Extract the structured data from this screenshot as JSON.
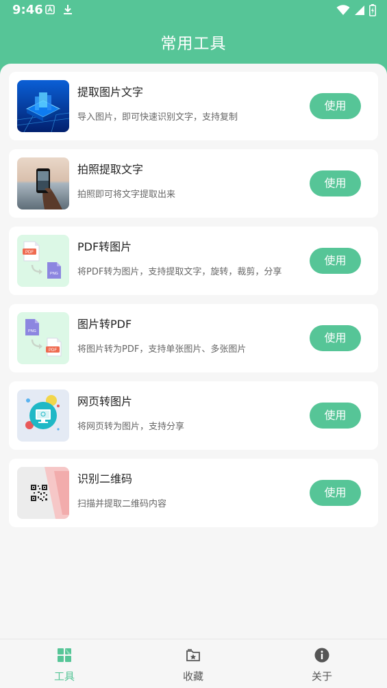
{
  "status_bar": {
    "time": "9:46"
  },
  "header": {
    "title": "常用工具"
  },
  "tools": [
    {
      "title": "提取图片文字",
      "desc": "导入图片，即可快速识别文字，支持复制",
      "button": "使用"
    },
    {
      "title": "拍照提取文字",
      "desc": "拍照即可将文字提取出来",
      "button": "使用"
    },
    {
      "title": "PDF转图片",
      "desc": "将PDF转为图片，支持提取文字，旋转，裁剪，分享",
      "button": "使用"
    },
    {
      "title": "图片转PDF",
      "desc": "将图片转为PDF，支持单张图片、多张图片",
      "button": "使用"
    },
    {
      "title": "网页转图片",
      "desc": "将网页转为图片，支持分享",
      "button": "使用"
    },
    {
      "title": "识别二维码",
      "desc": "扫描并提取二维码内容",
      "button": "使用"
    }
  ],
  "thumb_labels": {
    "pdf": "PDF",
    "png": "PNG"
  },
  "bottom_nav": [
    {
      "label": "工具",
      "icon": "grid-icon",
      "active": true
    },
    {
      "label": "收藏",
      "icon": "folder-star-icon",
      "active": false
    },
    {
      "label": "关于",
      "icon": "info-icon",
      "active": false
    }
  ],
  "colors": {
    "accent": "#56c597",
    "background": "#f6f6f6"
  }
}
